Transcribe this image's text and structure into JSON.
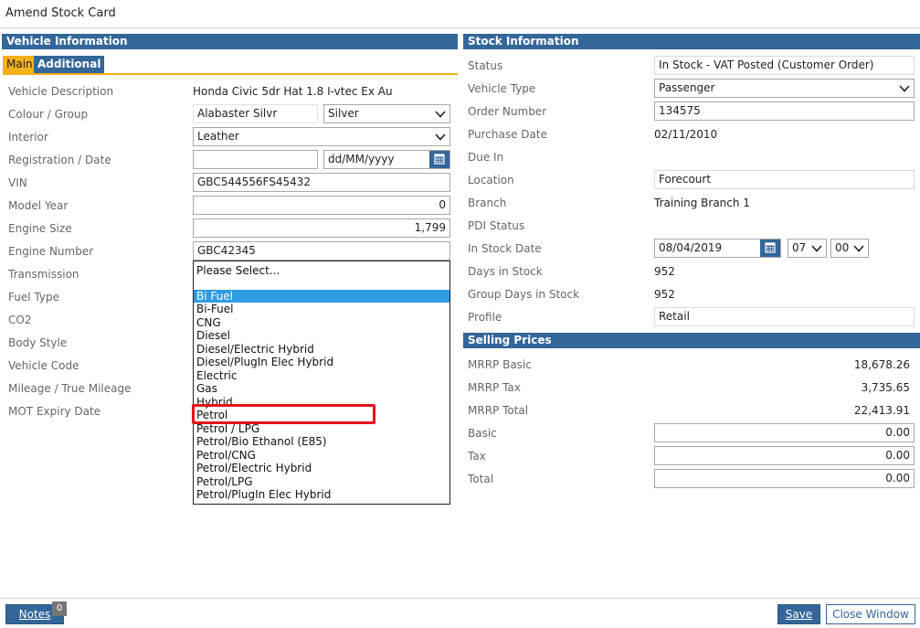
{
  "window": {
    "title": "Amend Stock Card"
  },
  "vehicle": {
    "header": "Vehicle Information",
    "tabs": [
      "Main",
      "Additional"
    ],
    "labels": {
      "description": "Vehicle Description",
      "colour": "Colour / Group",
      "interior": "Interior",
      "registration": "Registration / Date",
      "vin": "VIN",
      "model_year": "Model Year",
      "engine_size": "Engine Size",
      "engine_number": "Engine Number",
      "transmission": "Transmission",
      "fuel_type": "Fuel Type",
      "co2": "CO2",
      "body_style": "Body Style",
      "vehicle_code": "Vehicle Code",
      "mileage": "Mileage / True Mileage",
      "mot": "MOT Expiry Date"
    },
    "values": {
      "description": "Honda Civic 5dr Hat 1.8 I-vtec Ex Au",
      "colour_name": "Alabaster Silvr",
      "colour_group": "Silver",
      "interior": "Leather",
      "registration": "",
      "date_placeholder": "dd/MM/yyyy",
      "vin": "GBC544556FS45432",
      "model_year": "0",
      "engine_size": "1,799",
      "engine_number": "GBC42345"
    },
    "fuel_dropdown": {
      "placeholder": "Please Select...",
      "options": [
        "Bi Fuel",
        "Bi-Fuel",
        "CNG",
        "Diesel",
        "Diesel/Electric Hybrid",
        "Diesel/PlugIn Elec Hybrid",
        "Electric",
        "Gas",
        "Hybrid",
        "Petrol",
        "Petrol / LPG",
        "Petrol/Bio Ethanol (E85)",
        "Petrol/CNG",
        "Petrol/Electric Hybrid",
        "Petrol/LPG",
        "Petrol/PlugIn Elec Hybrid"
      ],
      "highlighted": "Bi Fuel",
      "annotated": "Petrol"
    }
  },
  "stock": {
    "header": "Stock Information",
    "labels": {
      "status": "Status",
      "vehicle_type": "Vehicle Type",
      "order_number": "Order Number",
      "purchase_date": "Purchase Date",
      "due_in": "Due In",
      "location": "Location",
      "branch": "Branch",
      "pdi_status": "PDI Status",
      "in_stock_date": "In Stock Date",
      "days_in_stock": "Days in Stock",
      "group_days": "Group Days in Stock",
      "profile": "Profile"
    },
    "values": {
      "status": "In Stock - VAT Posted (Customer Order)",
      "vehicle_type": "Passenger",
      "order_number": "134575",
      "purchase_date": "02/11/2010",
      "location": "Forecourt",
      "branch": "Training Branch 1",
      "in_stock_date": "08/04/2019",
      "hour": "07",
      "minute": "00",
      "days_in_stock": "952",
      "group_days": "952",
      "profile": "Retail"
    }
  },
  "prices": {
    "header": "Selling Prices",
    "labels": {
      "mrrp_basic": "MRRP Basic",
      "mrrp_tax": "MRRP Tax",
      "mrrp_total": "MRRP Total",
      "basic": "Basic",
      "tax": "Tax",
      "total": "Total"
    },
    "values": {
      "mrrp_basic": "18,678.26",
      "mrrp_tax": "3,735.65",
      "mrrp_total": "22,413.91",
      "basic": "0.00",
      "tax": "0.00",
      "total": "0.00"
    }
  },
  "footer": {
    "notes_label": "Notes",
    "notes_count": "0",
    "save_label": "Save",
    "close_label": "Close Window"
  },
  "colors": {
    "header_blue": "#336699",
    "tab_orange": "#f6b01a",
    "highlight_blue": "#2f9be3",
    "annotation_red": "#e4121b"
  }
}
